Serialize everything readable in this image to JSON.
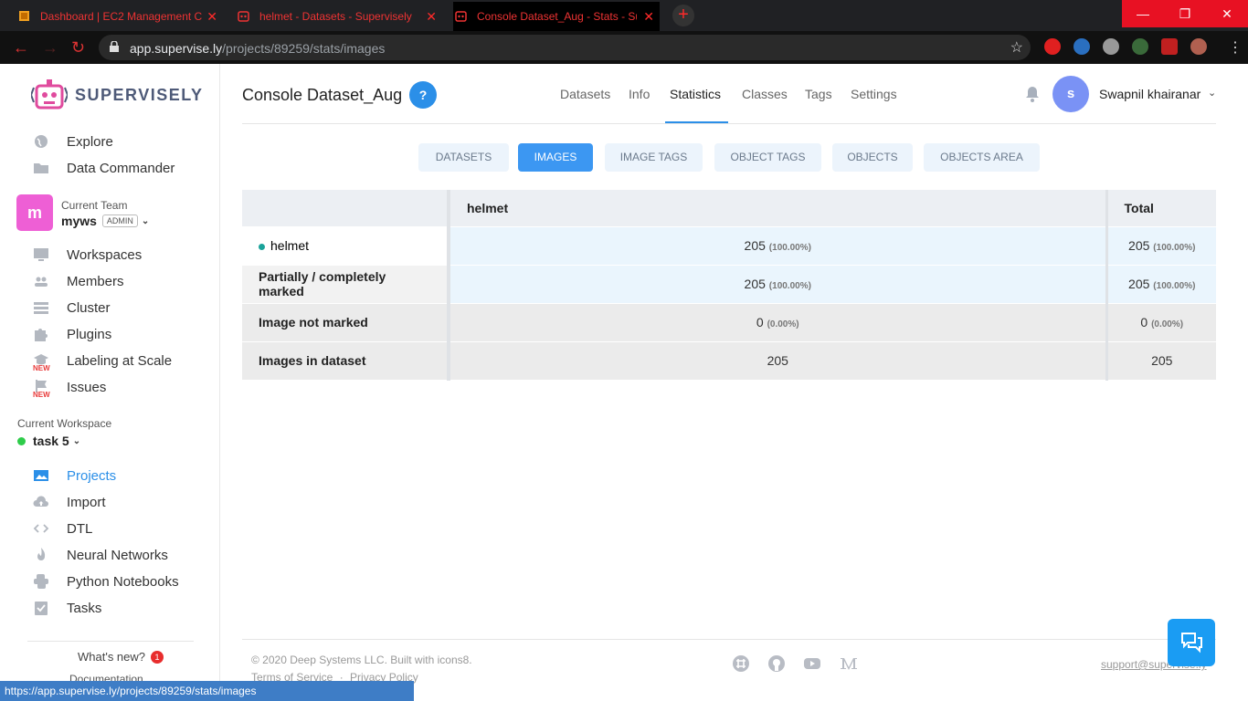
{
  "browser": {
    "tabs": [
      {
        "title": "Dashboard | EC2 Management C"
      },
      {
        "title": "helmet - Datasets - Supervisely"
      },
      {
        "title": "Console Dataset_Aug - Stats - Su"
      }
    ],
    "url_host": "app.supervise.ly",
    "url_path": "/projects/89259/stats/images",
    "status_url": "https://app.supervise.ly/projects/89259/stats/images"
  },
  "sidebar": {
    "brand": "SUPERVISELY",
    "top_items": [
      {
        "label": "Explore",
        "icon": "globe-icon"
      },
      {
        "label": "Data Commander",
        "icon": "folder-icon"
      }
    ],
    "team": {
      "caption": "Current Team",
      "initial": "m",
      "name": "myws",
      "role": "ADMIN"
    },
    "team_items": [
      {
        "label": "Workspaces",
        "icon": "monitor-icon"
      },
      {
        "label": "Members",
        "icon": "members-icon"
      },
      {
        "label": "Cluster",
        "icon": "cluster-icon"
      },
      {
        "label": "Plugins",
        "icon": "puzzle-icon"
      },
      {
        "label": "Labeling at Scale",
        "icon": "graduation-icon",
        "badge": "NEW"
      },
      {
        "label": "Issues",
        "icon": "flag-icon",
        "badge": "NEW"
      }
    ],
    "workspace": {
      "caption": "Current Workspace",
      "name": "task 5"
    },
    "ws_items": [
      {
        "label": "Projects",
        "icon": "images-icon",
        "active": true
      },
      {
        "label": "Import",
        "icon": "cloud-upload-icon"
      },
      {
        "label": "DTL",
        "icon": "code-icon"
      },
      {
        "label": "Neural Networks",
        "icon": "flame-icon"
      },
      {
        "label": "Python Notebooks",
        "icon": "python-icon"
      },
      {
        "label": "Tasks",
        "icon": "checklist-icon"
      }
    ],
    "whats_new": "What's new?",
    "whats_new_count": "1",
    "docs": "Documentation"
  },
  "header": {
    "project_title": "Console Dataset_Aug",
    "help": "?",
    "tabs": [
      "Datasets",
      "Info",
      "Statistics",
      "Classes",
      "Tags",
      "Settings"
    ],
    "active_tab": "Statistics",
    "user_initial": "s",
    "user_name": "Swapnil khairanar"
  },
  "stat_tabs": [
    "DATASETS",
    "IMAGES",
    "IMAGE TAGS",
    "OBJECT TAGS",
    "OBJECTS",
    "OBJECTS AREA"
  ],
  "active_stat_tab": "IMAGES",
  "table": {
    "headers": [
      "",
      "helmet",
      "Total"
    ],
    "rows": [
      {
        "label": "helmet",
        "val": "205",
        "pct": "(100.00%)",
        "total": "205",
        "total_pct": "(100.00%)"
      },
      {
        "label": "Partially / completely marked",
        "val": "205",
        "pct": "(100.00%)",
        "total": "205",
        "total_pct": "(100.00%)"
      },
      {
        "label": "Image not marked",
        "val": "0",
        "pct": "(0.00%)",
        "total": "0",
        "total_pct": "(0.00%)"
      },
      {
        "label": "Images in dataset",
        "val": "205",
        "pct": "",
        "total": "205",
        "total_pct": ""
      }
    ]
  },
  "footer": {
    "copyright": "© 2020 Deep Systems LLC. Built with icons8.",
    "terms": "Terms of Service",
    "separator": "·",
    "privacy": "Privacy Policy",
    "support": "support@supervise.ly"
  }
}
